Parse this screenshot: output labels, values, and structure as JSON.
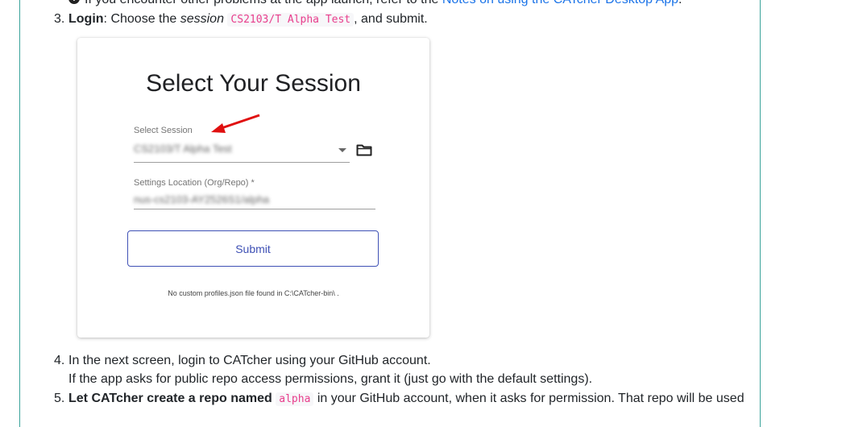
{
  "top_line": {
    "info_glyph": "!",
    "before_link": "If you encounter other problems at the app launch, refer to the ",
    "link": "Notes on using the CATcher Desktop App",
    "after_link": "."
  },
  "step3": {
    "number": "3.",
    "bold": "Login",
    "text1": ": Choose the ",
    "italic": "session",
    "code": "CS2103/T Alpha Test",
    "text2": ", and submit."
  },
  "card": {
    "title": "Select Your Session",
    "session_label": "Select Session",
    "session_value": "CS2103/T Alpha Test",
    "settings_label": "Settings Location (Org/Repo) *",
    "settings_value": "nus-cs2103-AY2526S1/alpha",
    "submit_label": "Submit",
    "note": "No custom profiles.json file found in C:\\CATcher-bin\\ .",
    "arrow_color": "#e01010"
  },
  "step4": {
    "number": "4.",
    "line1": "In the next screen, login to CATcher using your GitHub account.",
    "line2": "If the app asks for public repo access permissions, grant it (just go with the default settings)."
  },
  "step5": {
    "number": "5.",
    "bold": "Let CATcher create a repo named ",
    "code": "alpha",
    "text": " in your GitHub account, when it asks for permission. That repo will be used"
  }
}
